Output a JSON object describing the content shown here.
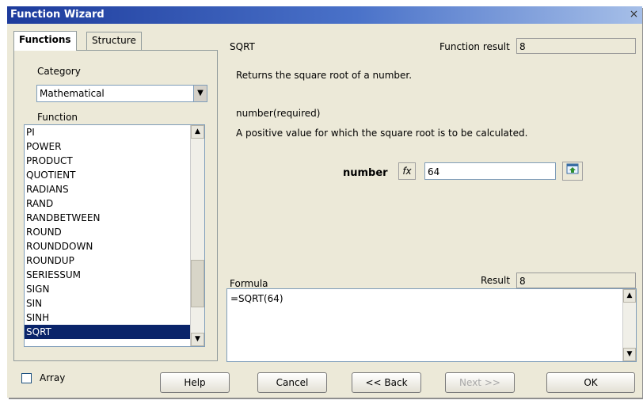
{
  "window": {
    "title": "Function Wizard",
    "close_glyph": "×"
  },
  "tabs": [
    {
      "label": "Functions",
      "active": true
    },
    {
      "label": "Structure",
      "active": false
    }
  ],
  "left": {
    "category_label": "Category",
    "category_value": "Mathematical",
    "function_label": "Function",
    "functions": [
      "PI",
      "POWER",
      "PRODUCT",
      "QUOTIENT",
      "RADIANS",
      "RAND",
      "RANDBETWEEN",
      "ROUND",
      "ROUNDDOWN",
      "ROUNDUP",
      "SERIESSUM",
      "SIGN",
      "SIN",
      "SINH",
      "SQRT"
    ],
    "selected_function": "SQRT"
  },
  "right": {
    "function_name": "SQRT",
    "function_result_label": "Function result",
    "function_result_value": "8",
    "description": "Returns the square root of a number.",
    "param_name_required": "number(required)",
    "param_description": "A positive value for which the square root is to be calculated.",
    "param_label": "number",
    "fx_glyph": "fx",
    "param_value": "64",
    "formula_label": "Formula",
    "result_label": "Result",
    "result_value": "8",
    "formula_text": "=SQRT(64)"
  },
  "bottom": {
    "array_label": "Array",
    "help_label": "Help",
    "cancel_label": "Cancel",
    "back_label": "<< Back",
    "next_label": "Next >>",
    "ok_label": "OK"
  },
  "colors": {
    "title_bar": "#1d3b9c",
    "selection": "#0a246a",
    "dialog_bg": "#ece9d8"
  }
}
